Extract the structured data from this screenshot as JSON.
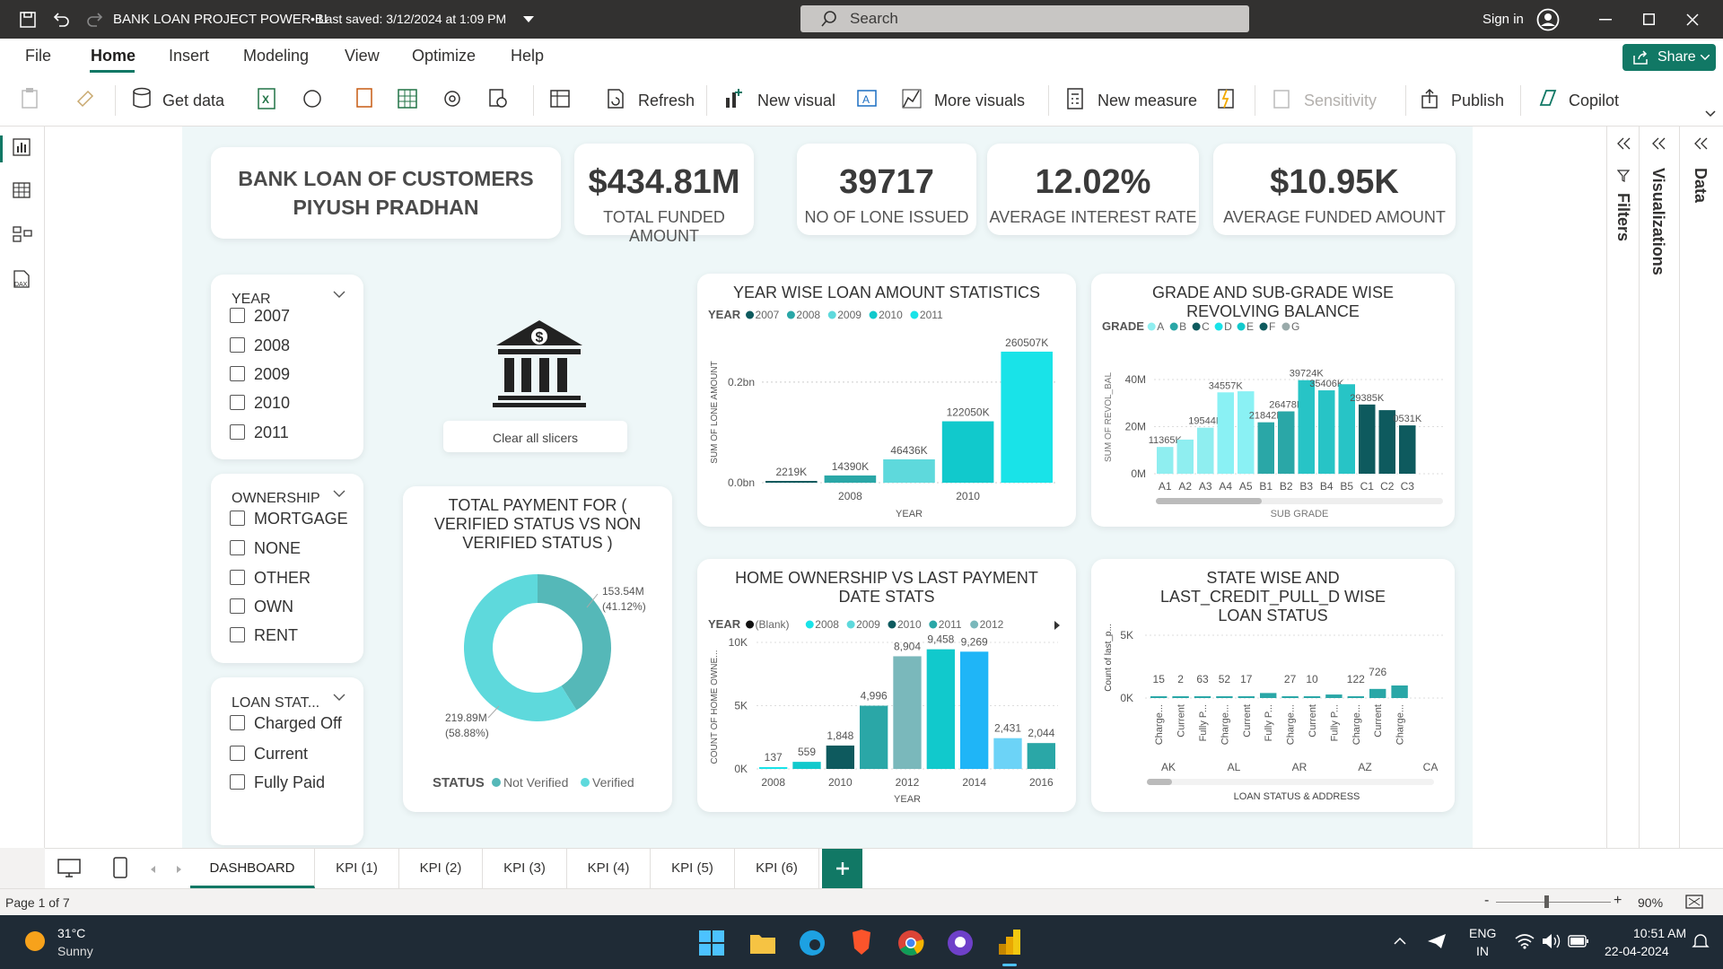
{
  "titlebar": {
    "document_title": "BANK LOAN PROJECT POWER BI",
    "saved_status": "• Last saved: 3/12/2024 at 1:09 PM",
    "search_placeholder": "Search",
    "sign_in": "Sign in"
  },
  "menu": {
    "items": [
      "File",
      "Home",
      "Insert",
      "Modeling",
      "View",
      "Optimize",
      "Help"
    ],
    "active": "Home",
    "share": "Share"
  },
  "ribbon": {
    "get_data": "Get data",
    "refresh": "Refresh",
    "new_visual": "New visual",
    "more_visuals": "More visuals",
    "new_measure": "New measure",
    "sensitivity": "Sensitivity",
    "publish": "Publish",
    "copilot": "Copilot"
  },
  "header_card": {
    "line1": "BANK LOAN OF CUSTOMERS",
    "line2": "PIYUSH PRADHAN"
  },
  "kpis": [
    {
      "value": "$434.81M",
      "label": "TOTAL FUNDED AMOUNT"
    },
    {
      "value": "39717",
      "label": "NO OF LONE ISSUED"
    },
    {
      "value": "12.02%",
      "label": "AVERAGE INTEREST RATE"
    },
    {
      "value": "$10.95K",
      "label": "AVERAGE FUNDED AMOUNT"
    }
  ],
  "slicers": {
    "year": {
      "title": "YEAR",
      "items": [
        "2007",
        "2008",
        "2009",
        "2010",
        "2011"
      ]
    },
    "ownership": {
      "title": "OWNERSHIP",
      "items": [
        "MORTGAGE",
        "NONE",
        "OTHER",
        "OWN",
        "RENT"
      ]
    },
    "loan_status": {
      "title": "LOAN STAT...",
      "items": [
        "Charged Off",
        "Current",
        "Fully Paid"
      ]
    }
  },
  "clear_slicers": "Clear all slicers",
  "colors": {
    "accent": "#117865",
    "teal1": "#0e5a5e",
    "teal2": "#2aa7a7",
    "teal3": "#5ed9dc",
    "teal4": "#11c9cc",
    "cyan": "#19e3e8",
    "blue": "#1fb5f7",
    "mint": "#8feef0"
  },
  "chart_data": [
    {
      "type": "bar",
      "title": "YEAR WISE LOAN AMOUNT STATISTICS",
      "legend_title": "YEAR",
      "legend": [
        "2007",
        "2008",
        "2009",
        "2010",
        "2011"
      ],
      "categories": [
        "2007",
        "2008",
        "2009",
        "2010",
        "2011"
      ],
      "values": [
        2219,
        14390,
        46436,
        122050,
        260507
      ],
      "data_labels": [
        "2219K",
        "14390K",
        "46436K",
        "122050K",
        "260507K"
      ],
      "x_ticks": [
        "2008",
        "2010"
      ],
      "y_ticks": [
        "0.0bn",
        "0.2bn"
      ],
      "xlabel": "YEAR",
      "ylabel": "SUM OF LONE AMOUNT"
    },
    {
      "type": "bar",
      "title": "GRADE AND SUB-GRADE WISE REVOLVING BALANCE",
      "legend_title": "GRADE",
      "legend": [
        "A",
        "B",
        "C",
        "D",
        "E",
        "F",
        "G"
      ],
      "categories": [
        "A1",
        "A2",
        "A3",
        "A4",
        "A5",
        "B1",
        "B2",
        "B3",
        "B4",
        "B5",
        "C1",
        "C2",
        "C3"
      ],
      "values": [
        11365,
        14500,
        19544,
        34557,
        35000,
        21842,
        26478,
        39724,
        35406,
        38000,
        29385,
        27000,
        20531
      ],
      "data_labels": [
        "11365K",
        "",
        "19544K",
        "34557K",
        "",
        "21842K",
        "26478K",
        "39724K",
        "35406K",
        "",
        "29385K",
        "",
        "0531K"
      ],
      "y_ticks": [
        "0M",
        "20M",
        "40M"
      ],
      "xlabel": "SUB GRADE",
      "ylabel": "SUM OF REVOL_BAL"
    },
    {
      "type": "pie",
      "title": "TOTAL PAYMENT FOR ( VERIFIED STATUS VS NON VERIFIED STATUS )",
      "legend_title": "STATUS",
      "slices": [
        {
          "name": "Not Verified",
          "value": 219.89,
          "label": "219.89M",
          "pct": "(58.88%)"
        },
        {
          "name": "Verified",
          "value": 153.54,
          "label": "153.54M",
          "pct": "(41.12%)"
        }
      ]
    },
    {
      "type": "bar",
      "title": "HOME OWNERSHIP VS LAST PAYMENT DATE STATS",
      "legend_title": "YEAR",
      "legend": [
        "(Blank)",
        "2008",
        "2009",
        "2010",
        "2011",
        "2012"
      ],
      "categories": [
        "2007",
        "2008",
        "2010",
        "2011",
        "2012",
        "2013",
        "2014",
        "2015",
        "2016"
      ],
      "values": [
        137,
        559,
        1848,
        4996,
        8904,
        9458,
        9269,
        2431,
        2044
      ],
      "x_ticks": [
        "2008",
        "2010",
        "2012",
        "2014",
        "2016"
      ],
      "y_ticks": [
        "0K",
        "5K",
        "10K"
      ],
      "xlabel": "YEAR",
      "ylabel": "COUNT OF HOME OWNE..."
    },
    {
      "type": "bar",
      "title": "STATE WISE AND LAST_CREDIT_PULL_D WISE LOAN STATUS",
      "categories": [
        "Charge...",
        "Current",
        "Fully P...",
        "Charge...",
        "Current",
        "Fully P...",
        "Charge...",
        "Current",
        "Fully P...",
        "Charge...",
        "Current",
        "Charge..."
      ],
      "values": [
        15,
        2,
        63,
        52,
        17,
        400,
        27,
        10,
        280,
        122,
        726,
        1000
      ],
      "data_labels": [
        "15",
        "2",
        "63",
        "52",
        "17",
        "",
        "27",
        "10",
        "",
        "122",
        "726",
        ""
      ],
      "groups": [
        "AK",
        "AL",
        "AR",
        "AZ",
        "CA"
      ],
      "y_ticks": [
        "0K",
        "5K"
      ],
      "xlabel": "LOAN STATUS & ADDRESS",
      "ylabel": "Count of last_p..."
    }
  ],
  "page_tabs": [
    "DASHBOARD",
    "KPI (1)",
    "KPI (2)",
    "KPI (3)",
    "KPI (4)",
    "KPI (5)",
    "KPI (6)"
  ],
  "panes": {
    "filters": "Filters",
    "visualizations": "Visualizations",
    "data": "Data"
  },
  "status": {
    "page": "Page 1 of 7",
    "zoom": "90%"
  },
  "taskbar": {
    "temp": "31°C",
    "weather": "Sunny",
    "lang1": "ENG",
    "lang2": "IN",
    "time": "10:51 AM",
    "date": "22-04-2024"
  }
}
